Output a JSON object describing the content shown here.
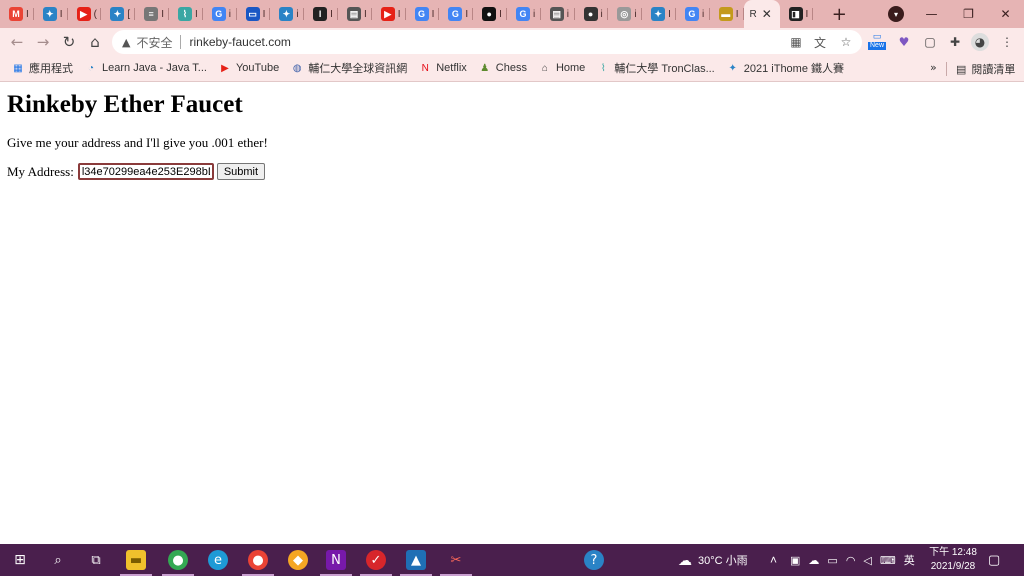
{
  "tabs": [
    {
      "letter": "M",
      "color": "#ea4335",
      "title": "I"
    },
    {
      "letter": "✦",
      "color": "#2a83c6",
      "title": "I"
    },
    {
      "letter": "▶",
      "color": "#e62117",
      "title": "("
    },
    {
      "letter": "✦",
      "color": "#2a83c6",
      "title": "["
    },
    {
      "letter": "≡",
      "color": "#777777",
      "title": "I"
    },
    {
      "letter": "⌇",
      "color": "#3aa7a3",
      "title": "I"
    },
    {
      "letter": "G",
      "color": "#4285f4",
      "title": "i"
    },
    {
      "letter": "▭",
      "color": "#1a57c4",
      "title": "I"
    },
    {
      "letter": "✦",
      "color": "#2a83c6",
      "title": "i"
    },
    {
      "letter": "I",
      "color": "#222222",
      "title": "I"
    },
    {
      "letter": "▤",
      "color": "#555555",
      "title": "I"
    },
    {
      "letter": "▶",
      "color": "#e62117",
      "title": "I"
    },
    {
      "letter": "G",
      "color": "#4285f4",
      "title": "I"
    },
    {
      "letter": "G",
      "color": "#4285f4",
      "title": "I"
    },
    {
      "letter": "●",
      "color": "#111111",
      "title": "I"
    },
    {
      "letter": "G",
      "color": "#4285f4",
      "title": "i"
    },
    {
      "letter": "▤",
      "color": "#555555",
      "title": "i"
    },
    {
      "letter": "●",
      "color": "#333333",
      "title": "i"
    },
    {
      "letter": "◎",
      "color": "#999999",
      "title": "i"
    },
    {
      "letter": "✦",
      "color": "#2a83c6",
      "title": "I"
    },
    {
      "letter": "G",
      "color": "#4285f4",
      "title": "i"
    },
    {
      "letter": "▬",
      "color": "#c49a1c",
      "title": "I"
    }
  ],
  "active_tab": {
    "title": "R",
    "close": "✕"
  },
  "tab_after": {
    "letter": "◨",
    "color": "#222222",
    "title": "I"
  },
  "new_tab": "+",
  "window": {
    "minimize": "—",
    "restore": "❐",
    "close": "✕"
  },
  "toolbar": {
    "back": "←",
    "forward": "→",
    "reload": "↻",
    "home": "⌂",
    "insecure_label": "不安全",
    "url": "rinkeby-faucet.com",
    "new_badge": "New",
    "menu": "⋮"
  },
  "bookmarks": [
    {
      "icon": "▦",
      "color": "#1a73e8",
      "label": "應用程式"
    },
    {
      "icon": "◔",
      "color": "#2a83c6",
      "label": "Learn Java - Java T..."
    },
    {
      "icon": "▶",
      "color": "#e62117",
      "label": "YouTube"
    },
    {
      "icon": "◍",
      "color": "#3b5ea8",
      "label": "輔仁大學全球資訊網"
    },
    {
      "icon": "N",
      "color": "#e50914",
      "label": "Netflix"
    },
    {
      "icon": "♟",
      "color": "#5d8a2e",
      "label": "Chess"
    },
    {
      "icon": "⌂",
      "color": "#444444",
      "label": "Home"
    },
    {
      "icon": "⌇",
      "color": "#3aa7a3",
      "label": "輔仁大學 TronClas..."
    },
    {
      "icon": "✦",
      "color": "#2a83c6",
      "label": "2021 iThome 鐵人賽"
    }
  ],
  "bookmarks_more": "»",
  "reading_list": "閱讀清單",
  "page": {
    "title": "Rinkeby Ether Faucet",
    "lead": "Give me your address and I'll give you .001 ether!",
    "address_label": "My Address:",
    "address_value": "l34e70299ea4e253E298bD",
    "submit_label": "Submit"
  },
  "taskbar": {
    "weather": "30°C 小雨",
    "ime": "英",
    "time": "下午 12:48",
    "date": "2021/9/28"
  }
}
